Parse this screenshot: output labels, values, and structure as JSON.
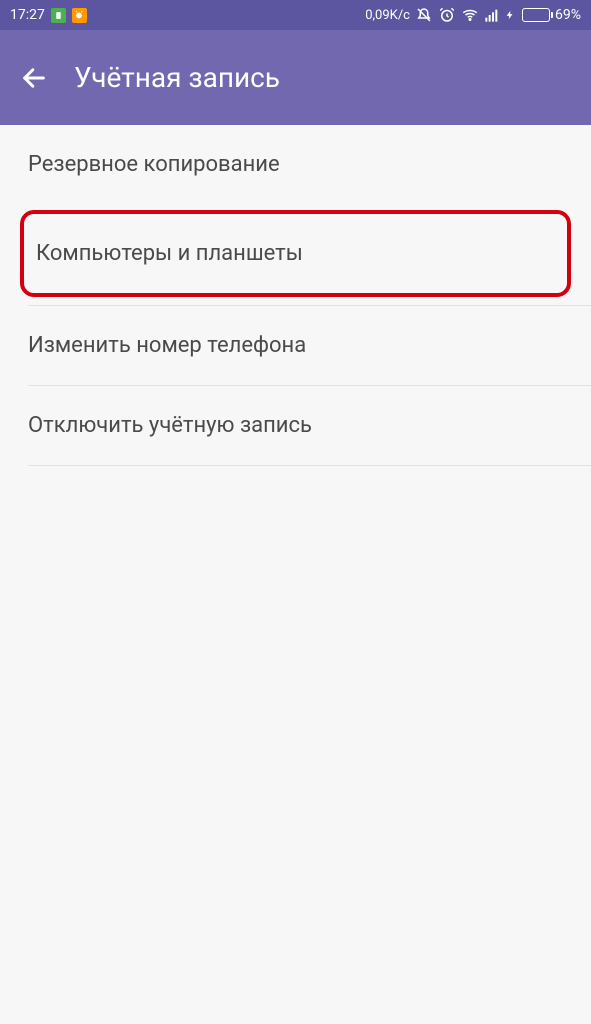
{
  "statusbar": {
    "time": "17:27",
    "net_rate": "0,09K/c",
    "battery_pct": "69%"
  },
  "header": {
    "title": "Учётная запись"
  },
  "menu": {
    "backup": "Резервное копирование",
    "devices": "Компьютеры и планшеты",
    "change_number": "Изменить номер телефона",
    "deactivate": "Отключить учётную запись"
  },
  "colors": {
    "appbar": "#7268b0",
    "statusbar": "#5b569f",
    "highlight_border": "#d4000e"
  }
}
